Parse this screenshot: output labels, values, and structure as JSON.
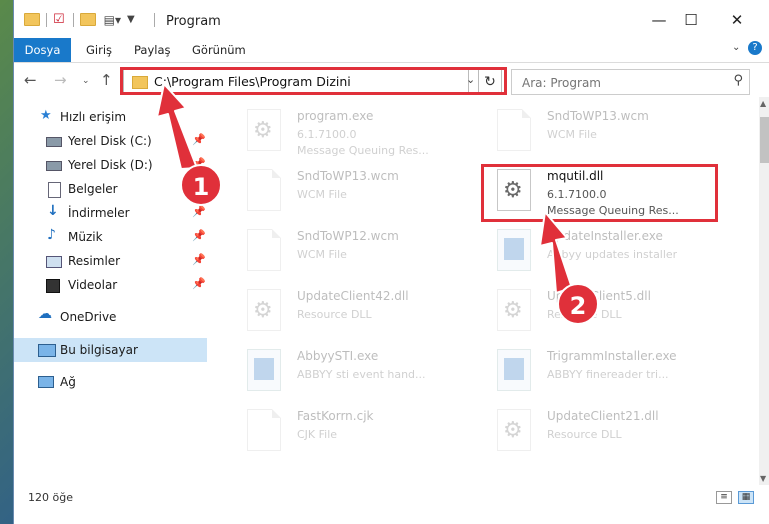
{
  "window": {
    "title": "Program",
    "tabs": [
      "Dosya",
      "Giriş",
      "Paylaş",
      "Görünüm"
    ]
  },
  "address": {
    "path": "C:\\Program Files\\Program Dizini"
  },
  "search": {
    "placeholder": "Ara: Program"
  },
  "sidebar": {
    "items": [
      {
        "label": "Hızlı erişim",
        "icon": "star-icon"
      },
      {
        "label": "Yerel Disk (C:)",
        "icon": "drive-icon"
      },
      {
        "label": "Yerel Disk (D:)",
        "icon": "drive-icon"
      },
      {
        "label": "Belgeler",
        "icon": "documents-icon"
      },
      {
        "label": "İndirmeler",
        "icon": "download-icon"
      },
      {
        "label": "Müzik",
        "icon": "music-icon"
      },
      {
        "label": "Resimler",
        "icon": "pictures-icon"
      },
      {
        "label": "Videolar",
        "icon": "videos-icon"
      },
      {
        "label": "OneDrive",
        "icon": "cloud-icon"
      },
      {
        "label": "Bu bilgisayar",
        "icon": "computer-icon"
      },
      {
        "label": "Ağ",
        "icon": "network-icon"
      }
    ]
  },
  "files": [
    {
      "name": "program.exe",
      "line2": "6.1.7100.0",
      "line3": "Message Queuing Res..."
    },
    {
      "name": "SndToWP13.wcm",
      "line2": "WCM File",
      "line3": ""
    },
    {
      "name": "SndToWP13.wcm",
      "line2": "WCM File",
      "line3": ""
    },
    {
      "name": "mqutil.dll",
      "line2": "6.1.7100.0",
      "line3": "Message Queuing Res..."
    },
    {
      "name": "SndToWP12.wcm",
      "line2": "WCM File",
      "line3": ""
    },
    {
      "name": "UpdateInstaller.exe",
      "line2": "Abbyy updates installer",
      "line3": ""
    },
    {
      "name": "UpdateClient42.dll",
      "line2": "Resource DLL",
      "line3": ""
    },
    {
      "name": "UpdateClient5.dll",
      "line2": "Resource DLL",
      "line3": ""
    },
    {
      "name": "AbbyySTI.exe",
      "line2": "ABBYY sti event hand...",
      "line3": ""
    },
    {
      "name": "TrigrammInstaller.exe",
      "line2": "ABBYY finereader tri...",
      "line3": ""
    },
    {
      "name": "FastKorrn.cjk",
      "line2": "CJK File",
      "line3": ""
    },
    {
      "name": "UpdateClient21.dll",
      "line2": "Resource DLL",
      "line3": ""
    }
  ],
  "status": {
    "count": "120 öğe"
  },
  "annotations": {
    "step1": "1",
    "step2": "2",
    "color": "#e0303a"
  }
}
